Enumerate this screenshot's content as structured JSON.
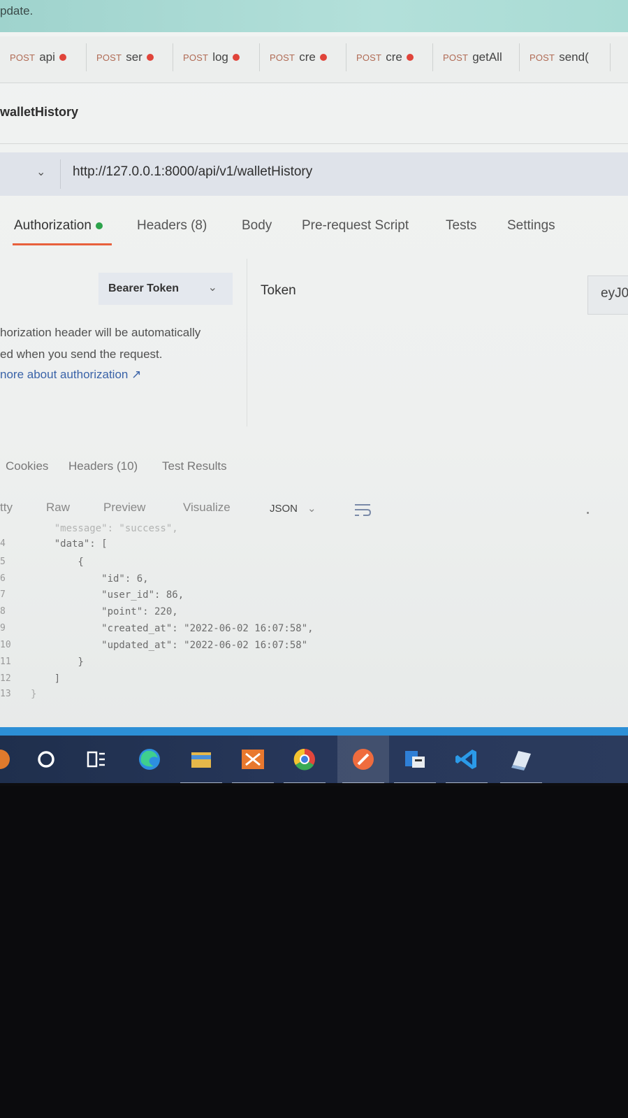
{
  "banner": {
    "text": "pdate."
  },
  "tabs": [
    {
      "method": "POST",
      "name": "api",
      "dirty": true
    },
    {
      "method": "POST",
      "name": "ser",
      "dirty": true
    },
    {
      "method": "POST",
      "name": "log",
      "dirty": true
    },
    {
      "method": "POST",
      "name": "cre",
      "dirty": true
    },
    {
      "method": "POST",
      "name": "cre",
      "dirty": true
    },
    {
      "method": "POST",
      "name": "getAll",
      "dirty": false
    },
    {
      "method": "POST",
      "name": "send(",
      "dirty": false
    }
  ],
  "request": {
    "name": "walletHistory",
    "url": "http://127.0.0.1:8000/api/v1/walletHistory"
  },
  "request_tabs": {
    "authorization": "Authorization",
    "headers": "Headers (8)",
    "body": "Body",
    "prerequest": "Pre-request Script",
    "tests": "Tests",
    "settings": "Settings"
  },
  "auth": {
    "type": "Bearer Token",
    "token_label": "Token",
    "token_value": "eyJ0",
    "note_line1": "horization header will be automatically",
    "note_line2": "ed when you send the request.",
    "note_link": "nore about authorization ↗"
  },
  "response_tabs": {
    "cookies": "Cookies",
    "headers": "Headers (10)",
    "tests": "Test Results"
  },
  "body_view": {
    "pretty": "tty",
    "raw": "Raw",
    "preview": "Preview",
    "visualize": "Visualize",
    "format": "JSON"
  },
  "code": {
    "line_numbers": [
      "",
      "4",
      "5",
      "6",
      "7",
      "8",
      "9",
      "10",
      "11",
      "12",
      "13"
    ],
    "lines": [
      "    \"message\": \"success\",",
      "    \"data\": [",
      "        {",
      "            \"id\": 6,",
      "            \"user_id\": 86,",
      "            \"point\": 220,",
      "            \"created_at\": \"2022-06-02 16:07:58\",",
      "            \"updated_at\": \"2022-06-02 16:07:58\"",
      "        }",
      "    ]",
      "}"
    ]
  },
  "taskbar": {
    "icons": [
      "cortana-icon",
      "task-view-icon",
      "edge-icon",
      "file-explorer-icon",
      "xampp-icon",
      "chrome-icon",
      "postman-icon",
      "server-icon",
      "vscode-icon",
      "notepad-icon"
    ]
  }
}
